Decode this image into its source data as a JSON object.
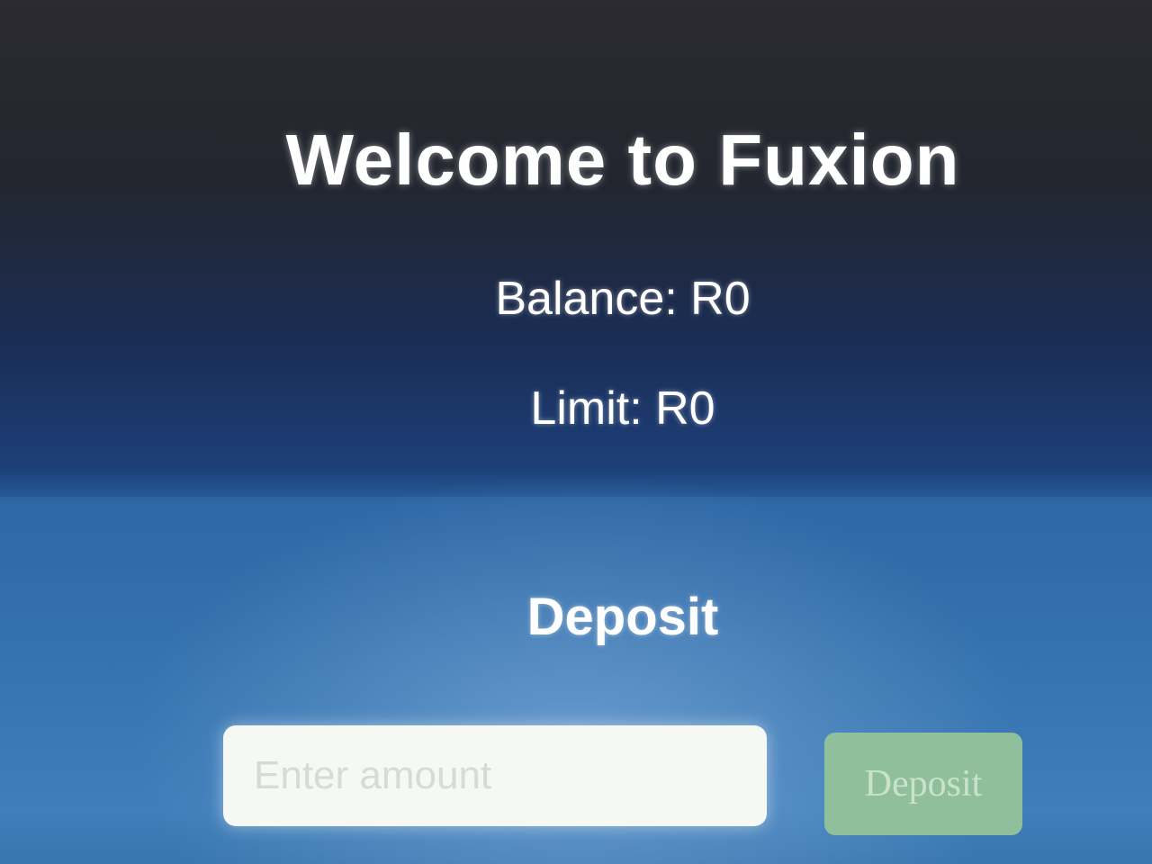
{
  "header": {
    "title": "Welcome to Fuxion"
  },
  "account": {
    "balance_text": "Balance: R0",
    "limit_text": "Limit: R0"
  },
  "deposit": {
    "heading": "Deposit",
    "amount_placeholder": "Enter amount",
    "amount_value": "",
    "button_label": "Deposit"
  },
  "colors": {
    "text": "#ffffff",
    "button_bg": "#8fc09b",
    "input_bg": "#f6f8f4"
  }
}
